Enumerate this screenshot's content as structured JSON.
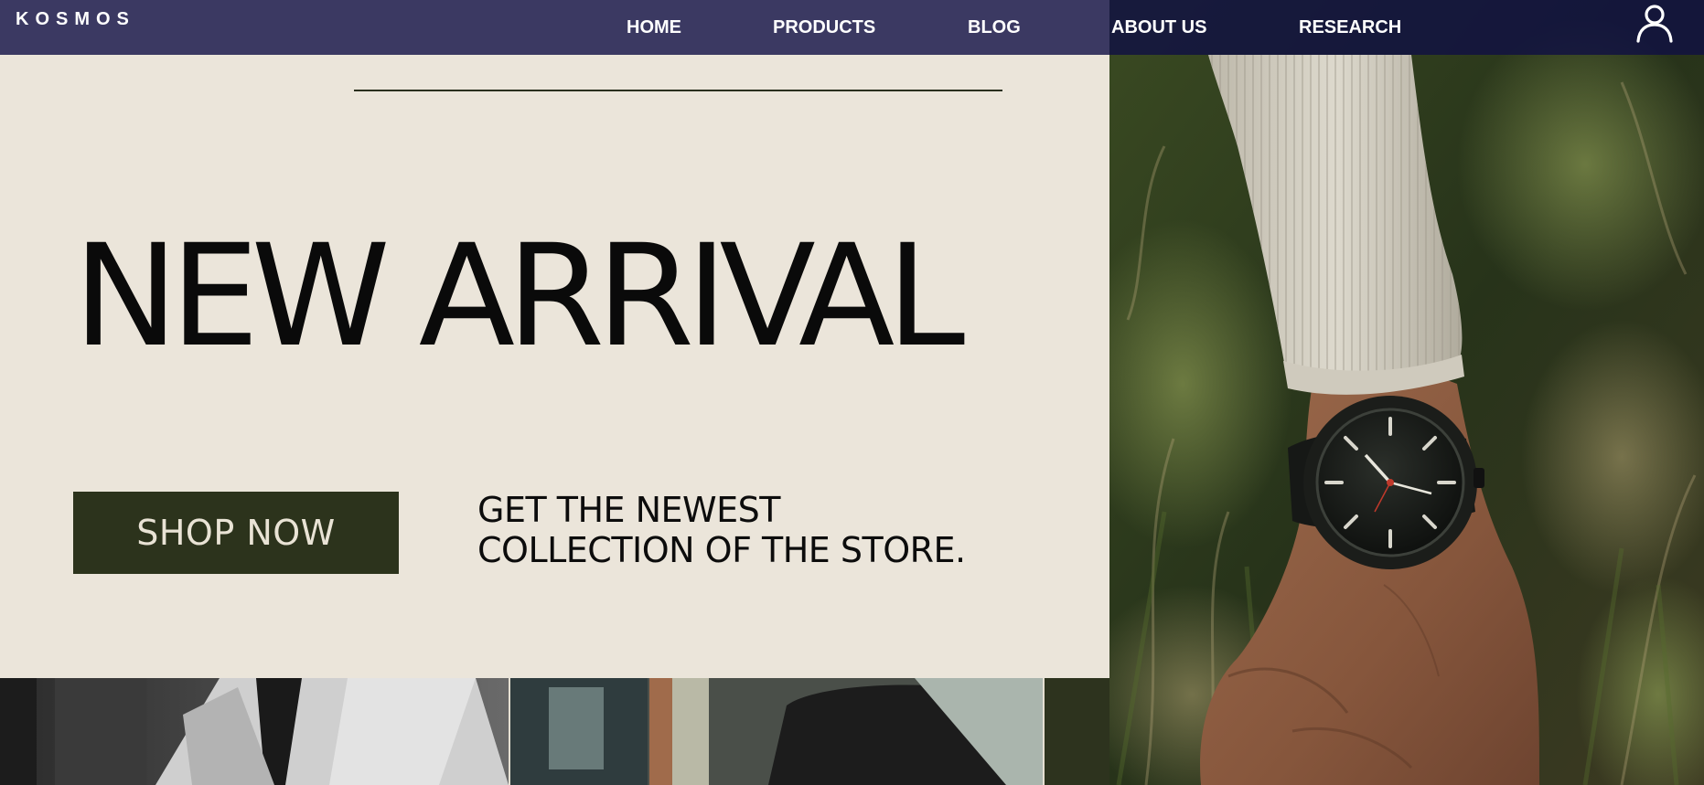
{
  "nav": {
    "logo": "KOSMOS",
    "links": [
      {
        "label": "HOME"
      },
      {
        "label": "PRODUCTS"
      },
      {
        "label": "BLOG"
      },
      {
        "label": "ABOUT US"
      },
      {
        "label": "RESEARCH"
      }
    ],
    "account_icon": "user-icon"
  },
  "hero": {
    "title": "NEW ARRIVAL",
    "cta_label": "SHOP NOW",
    "tagline_line1": "GET THE NEWEST",
    "tagline_line2": "COLLECTION OF THE STORE."
  },
  "colors": {
    "nav_bg": "#3b3962",
    "hero_bg": "#ebe5da",
    "cta_bg": "#2c331c",
    "cta_text": "#e9e3d5"
  }
}
